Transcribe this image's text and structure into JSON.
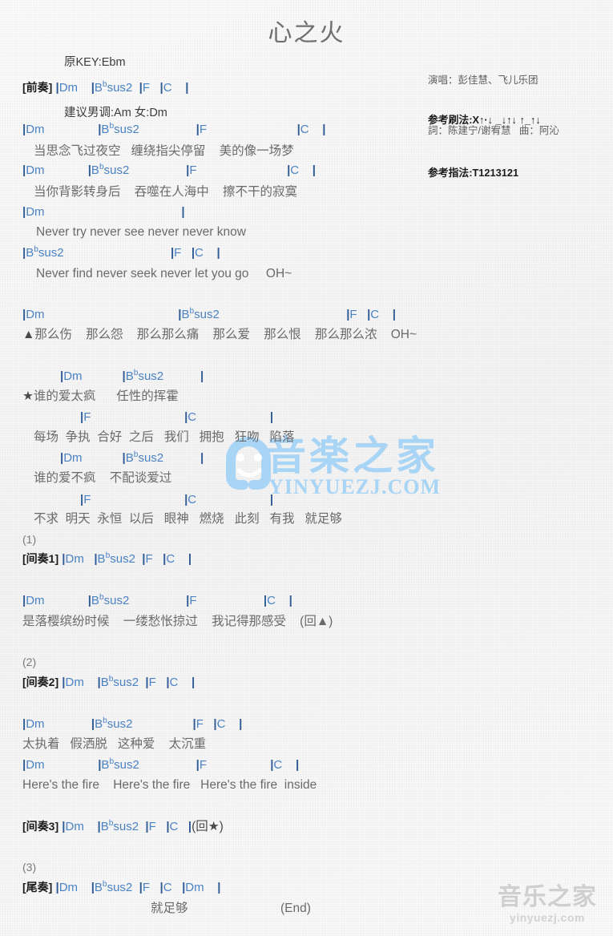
{
  "header": {
    "title": "心之火",
    "orig_key": "原KEY:Ebm",
    "suggest_key": "建议男调:Am 女:Dm",
    "singer": "演唱：彭佳慧、飞儿乐团",
    "writers": "詞：陈建宁/谢宥慧   曲：阿沁",
    "strum_pattern": "参考刷法:X↑·↓ _↓↑↓ ↑_↑↓",
    "finger_pattern": "参考指法:T1213121"
  },
  "chords": {
    "dm": "Dm",
    "bbsus2": "Bsus2",
    "bbsus2_root": "B",
    "bbsus2_flat": "b",
    "bbsus2_tail": "sus2",
    "f": "F",
    "c": "C"
  },
  "sections": {
    "intro": "[前奏]",
    "interlude1": "[间奏1]",
    "interlude2": "[间奏2]",
    "interlude3": "[间奏3]",
    "outro": "[尾奏]"
  },
  "markers": {
    "n1": "(1)",
    "n2": "(2)",
    "n3": "(3)",
    "triangle": "▲",
    "star": "★",
    "back_triangle": "(回▲)",
    "back_star": "(回★)",
    "end": "(End)"
  },
  "lyrics": {
    "v1_l1": "当思念飞过夜空   缠绕指尖停留    美的像一场梦",
    "v1_l2": "当你背影转身后    吞噬在人海中    擦不干的寂寞",
    "v1_l3": "Never try never see never never know",
    "v1_l4": "Never find never seek never let you go     OH~",
    "ch_l1_mark": "▲",
    "ch_l1": "那么伤    那么怨    那么那么痛    那么爱    那么恨    那么那么浓    OH~",
    "ch2_l1_mark": "★",
    "ch2_l1": "谁的爱太疯      任性的挥霍",
    "ch2_l2": "每场  争执  合好  之后   我们   拥抱   狂吻   陷落",
    "ch2_l3": "谁的爱不疯    不配谈爱过",
    "ch2_l4": "不求  明天  永恒  以后   眼神   燃烧   此刻   有我   就足够",
    "v2_l1": "是落樱缤纷时候    一缕愁怅掠过    我记得那感受    (回▲)",
    "v3_l1": "太执着   假洒脱   这种爱    太沉重",
    "v3_l2": "Here's the fire    Here's the fire   Here's the fire  inside",
    "outro_l1": "就足够",
    "outro_end": "(End)"
  },
  "watermark": {
    "center_cn": "音楽之家",
    "center_en": "YINYUEZJ.COM",
    "bottom_cn": "音乐之家",
    "bottom_en": "yinyuezj.com"
  },
  "colors": {
    "chord": "#4a82c3",
    "bar": "#2f5c94",
    "lyric": "#6a6a6a",
    "section": "#1c1c1c",
    "watermark_blue": "#a8d4f5",
    "watermark_grey": "#cfcfcf"
  }
}
